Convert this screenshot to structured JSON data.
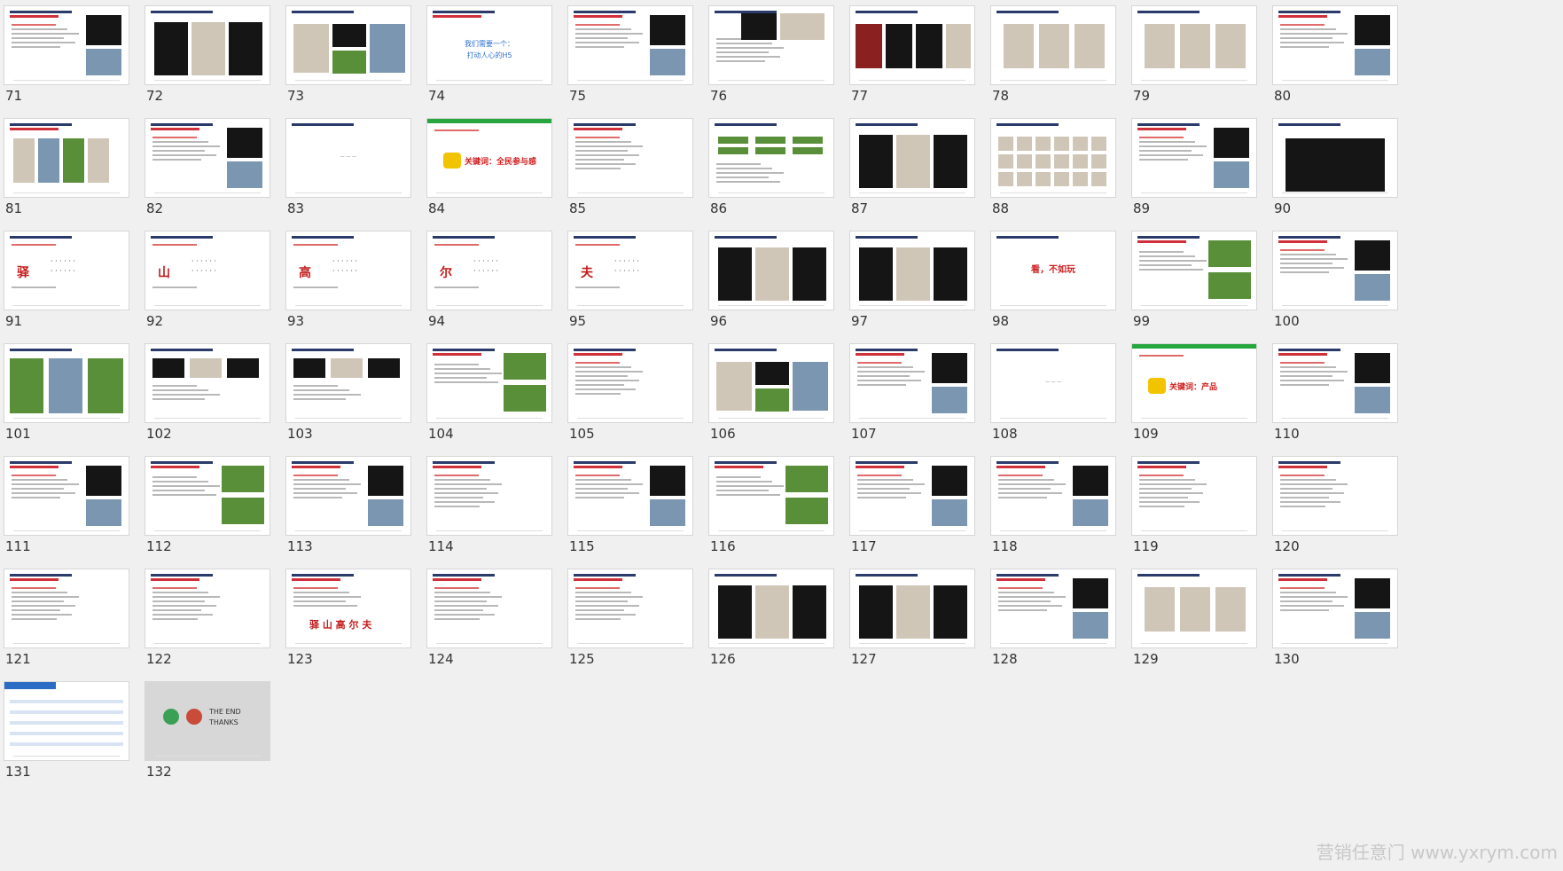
{
  "slides": [
    {
      "n": "71",
      "kind": "text-img"
    },
    {
      "n": "72",
      "kind": "phones"
    },
    {
      "n": "73",
      "kind": "collage"
    },
    {
      "n": "74",
      "kind": "blue",
      "text": "我们需要一个：\n打动人心的H5"
    },
    {
      "n": "75",
      "kind": "text-img"
    },
    {
      "n": "76",
      "kind": "portrait"
    },
    {
      "n": "77",
      "kind": "posters"
    },
    {
      "n": "78",
      "kind": "light"
    },
    {
      "n": "79",
      "kind": "light"
    },
    {
      "n": "80",
      "kind": "text-img"
    },
    {
      "n": "81",
      "kind": "strip"
    },
    {
      "n": "82",
      "kind": "text-img"
    },
    {
      "n": "83",
      "kind": "blank"
    },
    {
      "n": "84",
      "kind": "keyword",
      "text": "关键词：全民参与感"
    },
    {
      "n": "85",
      "kind": "text"
    },
    {
      "n": "86",
      "kind": "diagram"
    },
    {
      "n": "87",
      "kind": "phones"
    },
    {
      "n": "88",
      "kind": "grid"
    },
    {
      "n": "89",
      "kind": "text-img"
    },
    {
      "n": "90",
      "kind": "video"
    },
    {
      "n": "91",
      "kind": "calli",
      "word": "驿"
    },
    {
      "n": "92",
      "kind": "calli",
      "word": "山"
    },
    {
      "n": "93",
      "kind": "calli",
      "word": "高"
    },
    {
      "n": "94",
      "kind": "calli",
      "word": "尔"
    },
    {
      "n": "95",
      "kind": "calli",
      "word": "夫"
    },
    {
      "n": "96",
      "kind": "phones"
    },
    {
      "n": "97",
      "kind": "phones"
    },
    {
      "n": "98",
      "kind": "bigred",
      "text": "看，不如玩"
    },
    {
      "n": "99",
      "kind": "text-green"
    },
    {
      "n": "100",
      "kind": "text-img"
    },
    {
      "n": "101",
      "kind": "three-green"
    },
    {
      "n": "102",
      "kind": "three-photo"
    },
    {
      "n": "103",
      "kind": "three-photo"
    },
    {
      "n": "104",
      "kind": "text-green"
    },
    {
      "n": "105",
      "kind": "text"
    },
    {
      "n": "106",
      "kind": "collage"
    },
    {
      "n": "107",
      "kind": "text-img"
    },
    {
      "n": "108",
      "kind": "blank"
    },
    {
      "n": "109",
      "kind": "keyword",
      "text": "关键词：产品"
    },
    {
      "n": "110",
      "kind": "text-img"
    },
    {
      "n": "111",
      "kind": "text-img"
    },
    {
      "n": "112",
      "kind": "text-green"
    },
    {
      "n": "113",
      "kind": "text-img"
    },
    {
      "n": "114",
      "kind": "text"
    },
    {
      "n": "115",
      "kind": "text-img"
    },
    {
      "n": "116",
      "kind": "text-green"
    },
    {
      "n": "117",
      "kind": "text-img"
    },
    {
      "n": "118",
      "kind": "text-img"
    },
    {
      "n": "119",
      "kind": "text"
    },
    {
      "n": "120",
      "kind": "text"
    },
    {
      "n": "121",
      "kind": "text"
    },
    {
      "n": "122",
      "kind": "text"
    },
    {
      "n": "123",
      "kind": "redline",
      "text": "驿 山 高 尔 夫"
    },
    {
      "n": "124",
      "kind": "text"
    },
    {
      "n": "125",
      "kind": "text"
    },
    {
      "n": "126",
      "kind": "phones"
    },
    {
      "n": "127",
      "kind": "phones"
    },
    {
      "n": "128",
      "kind": "text-img"
    },
    {
      "n": "129",
      "kind": "light"
    },
    {
      "n": "130",
      "kind": "text-img"
    },
    {
      "n": "131",
      "kind": "timeline"
    },
    {
      "n": "132",
      "kind": "end",
      "text1": "THE END",
      "text2": "THANKS"
    }
  ],
  "watermark": "营销任意门 www.yxrym.com"
}
